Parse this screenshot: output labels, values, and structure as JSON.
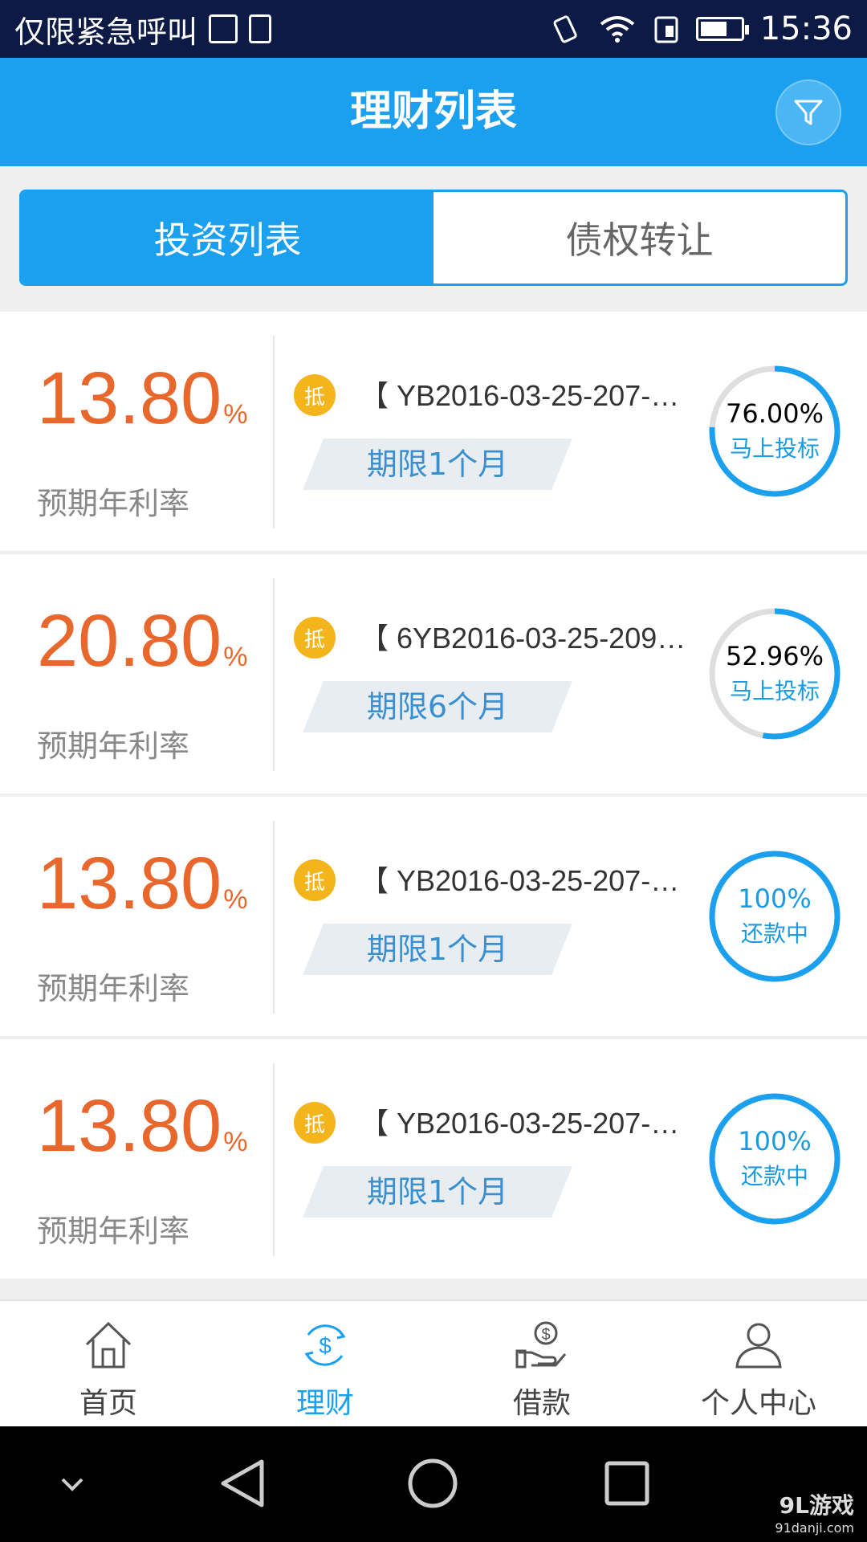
{
  "status_bar": {
    "carrier": "仅限紧急呼叫",
    "time": "15:36",
    "icons": [
      "image-icon",
      "upload-icon",
      "vibrate-icon",
      "wifi-icon",
      "sim-icon",
      "battery-icon"
    ]
  },
  "header": {
    "title": "理财列表",
    "filter_icon": "filter-icon"
  },
  "tabs": [
    {
      "label": "投资列表",
      "active": true
    },
    {
      "label": "债权转让",
      "active": false
    }
  ],
  "products": [
    {
      "rate": "13.80",
      "unit": "%",
      "rate_label": "预期年利率",
      "badge": "抵",
      "name": "【 YB2016-03-25-207-…",
      "term": "期限1个月",
      "progress": 0.76,
      "progress_text": "76.00%",
      "action": "马上投标"
    },
    {
      "rate": "20.80",
      "unit": "%",
      "rate_label": "预期年利率",
      "badge": "抵",
      "name": "【 6YB2016-03-25-209…",
      "term": "期限6个月",
      "progress": 0.5296,
      "progress_text": "52.96%",
      "action": "马上投标"
    },
    {
      "rate": "13.80",
      "unit": "%",
      "rate_label": "预期年利率",
      "badge": "抵",
      "name": "【 YB2016-03-25-207-…",
      "term": "期限1个月",
      "progress": 1.0,
      "progress_text": "100%",
      "action": "还款中"
    },
    {
      "rate": "13.80",
      "unit": "%",
      "rate_label": "预期年利率",
      "badge": "抵",
      "name": "【 YB2016-03-25-207-…",
      "term": "期限1个月",
      "progress": 1.0,
      "progress_text": "100%",
      "action": "还款中"
    }
  ],
  "bottom_nav": [
    {
      "label": "首页",
      "icon": "home-icon",
      "active": false
    },
    {
      "label": "理财",
      "icon": "finance-icon",
      "active": true
    },
    {
      "label": "借款",
      "icon": "loan-icon",
      "active": false
    },
    {
      "label": "个人中心",
      "icon": "user-icon",
      "active": false
    }
  ],
  "watermark": {
    "brand": "9L游戏",
    "url": "91danji.com"
  },
  "colors": {
    "primary": "#1aa0ee",
    "rate": "#e8672d",
    "badge": "#f4b51c",
    "status_bar": "#0c1a45"
  }
}
